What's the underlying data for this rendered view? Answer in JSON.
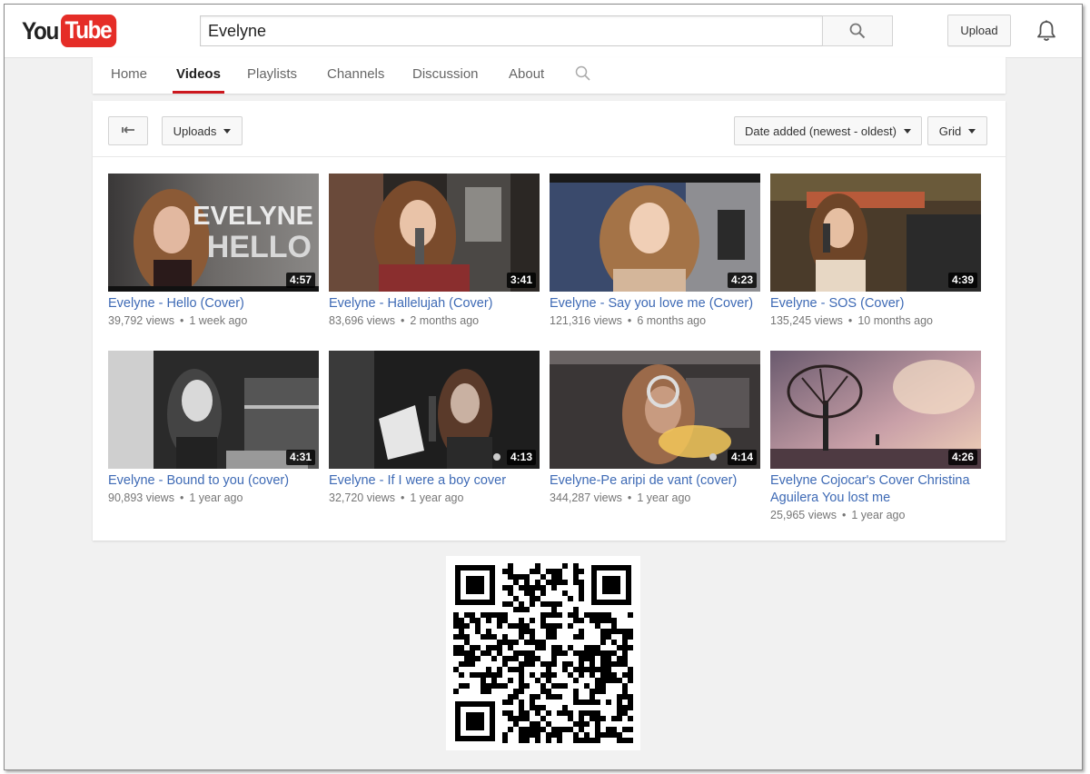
{
  "masthead": {
    "logo_you": "You",
    "logo_tube": "Tube",
    "search_value": "Evelyne",
    "upload_label": "Upload",
    "search_icon": "search-icon",
    "bell_icon": "bell-icon"
  },
  "tabs": [
    {
      "label": "Home",
      "active": false
    },
    {
      "label": "Videos",
      "active": true
    },
    {
      "label": "Playlists",
      "active": false
    },
    {
      "label": "Channels",
      "active": false
    },
    {
      "label": "Discussion",
      "active": false
    },
    {
      "label": "About",
      "active": false
    }
  ],
  "toolbar": {
    "back_icon": "back-arrow-icon",
    "uploads_label": "Uploads",
    "sort_label": "Date added (newest - oldest)",
    "view_label": "Grid"
  },
  "videos": [
    {
      "title": "Evelyne - Hello (Cover)",
      "views": "39,792 views",
      "age": "1 week ago",
      "duration": "4:57",
      "thumb_text_1": "EVELYNE",
      "thumb_text_2": "HELLO"
    },
    {
      "title": "Evelyne - Hallelujah (Cover)",
      "views": "83,696 views",
      "age": "2 months ago",
      "duration": "3:41"
    },
    {
      "title": "Evelyne - Say you love me (Cover)",
      "views": "121,316 views",
      "age": "6 months ago",
      "duration": "4:23"
    },
    {
      "title": "Evelyne - SOS (Cover)",
      "views": "135,245 views",
      "age": "10 months ago",
      "duration": "4:39"
    },
    {
      "title": "Evelyne - Bound to you (cover)",
      "views": "90,893 views",
      "age": "1 year ago",
      "duration": "4:31"
    },
    {
      "title": "Evelyne - If I were a boy cover",
      "views": "32,720 views",
      "age": "1 year ago",
      "duration": "4:13"
    },
    {
      "title": "Evelyne-Pe aripi de vant (cover)",
      "views": "344,287 views",
      "age": "1 year ago",
      "duration": "4:14"
    },
    {
      "title": "Evelyne Cojocar's Cover Christina Aguilera You lost me",
      "views": "25,965 views",
      "age": "1 year ago",
      "duration": "4:26"
    }
  ],
  "colors": {
    "brand_red": "#e52d27",
    "active_tab_underline": "#cc181e",
    "link_blue": "#3e6ab5"
  }
}
